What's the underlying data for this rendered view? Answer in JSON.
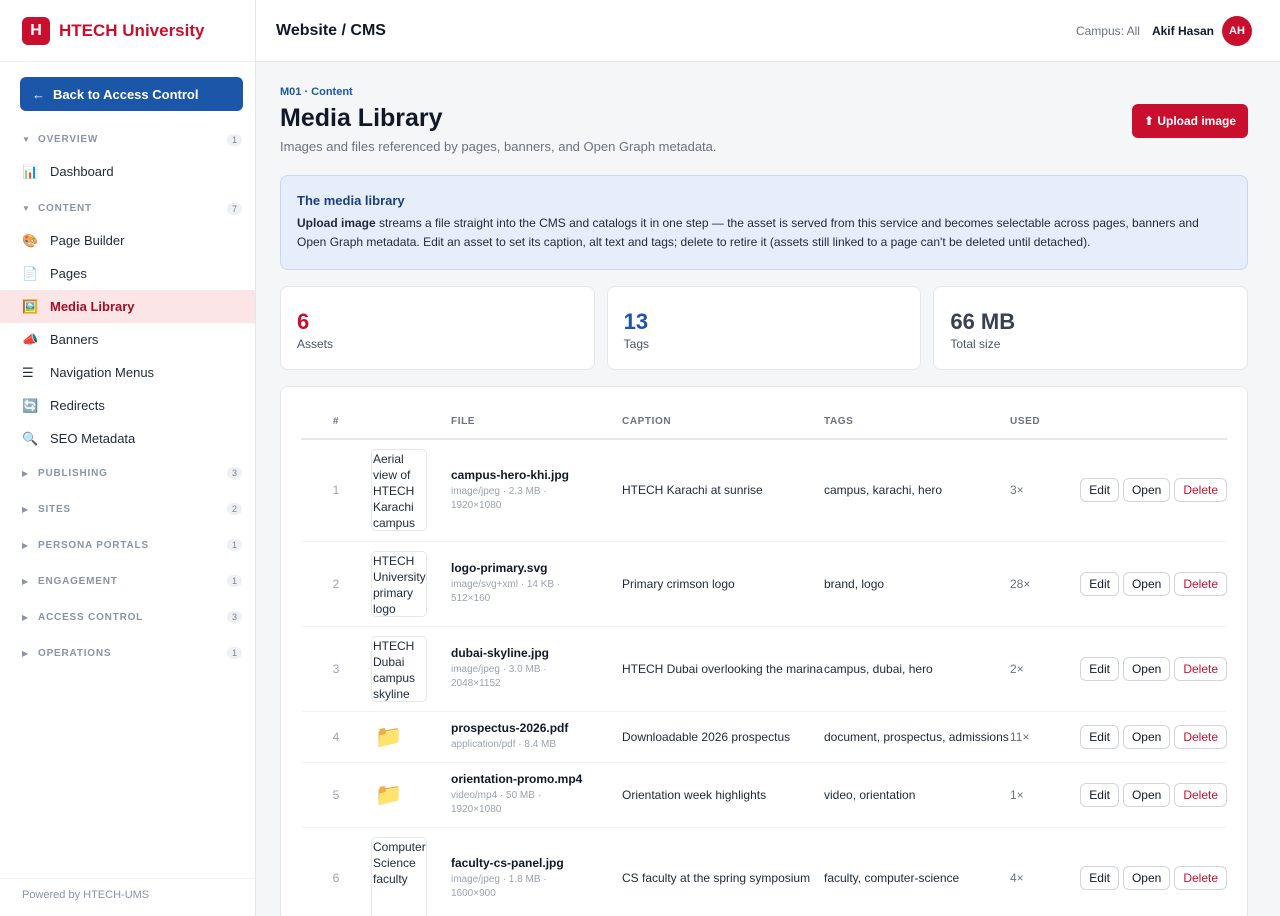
{
  "brand": {
    "logo_letter": "H",
    "name": "HTECH University"
  },
  "sidebar": {
    "back_label": "Back to Access Control",
    "back_arrow": "←",
    "overview": {
      "label": "OVERVIEW",
      "count": "1",
      "items": [
        {
          "icon": "📊",
          "label": "Dashboard"
        }
      ]
    },
    "content": {
      "label": "CONTENT",
      "count": "7",
      "items": [
        {
          "icon": "🎨",
          "label": "Page Builder"
        },
        {
          "icon": "📄",
          "label": "Pages"
        },
        {
          "icon": "🖼️",
          "label": "Media Library"
        },
        {
          "icon": "📣",
          "label": "Banners"
        },
        {
          "icon": "☰",
          "label": "Navigation Menus"
        },
        {
          "icon": "🔄",
          "label": "Redirects"
        },
        {
          "icon": "🔍",
          "label": "SEO Metadata"
        }
      ]
    },
    "sections": [
      {
        "label": "PUBLISHING",
        "count": "3"
      },
      {
        "label": "SITES",
        "count": "2"
      },
      {
        "label": "PERSONA PORTALS",
        "count": "1"
      },
      {
        "label": "ENGAGEMENT",
        "count": "1"
      },
      {
        "label": "ACCESS CONTROL",
        "count": "3"
      },
      {
        "label": "OPERATIONS",
        "count": "1"
      }
    ],
    "footer": "Powered by HTECH-UMS"
  },
  "topbar": {
    "title": "Website / CMS",
    "campus": "Campus: All",
    "user": "Akif Hasan",
    "initials": "AH"
  },
  "page": {
    "eyebrow": "M01 · Content",
    "title": "Media Library",
    "subtitle": "Images and files referenced by pages, banners, and Open Graph metadata.",
    "upload_label": "⬆ Upload image"
  },
  "info": {
    "title": "The media library",
    "lead": "Upload image",
    "body": " streams a file straight into the CMS and catalogs it in one step — the asset is served from this service and becomes selectable across pages, banners and Open Graph metadata. Edit an asset to set its caption, alt text and tags; delete to retire it (assets still linked to a page can't be deleted until detached)."
  },
  "stats": [
    {
      "value": "6",
      "label": "Assets"
    },
    {
      "value": "13",
      "label": "Tags"
    },
    {
      "value": "66 MB",
      "label": "Total size"
    }
  ],
  "table": {
    "headers": {
      "idx": "#",
      "file": "FILE",
      "caption": "CAPTION",
      "tags": "TAGS",
      "used": "USED"
    },
    "actions": {
      "edit": "Edit",
      "open": "Open",
      "delete": "Delete"
    },
    "rows": [
      {
        "idx": "1",
        "thumb": "Aerial view of HTECH Karachi campus",
        "name": "campus-hero-khi.jpg",
        "meta1": "image/jpeg · 2.3 MB ·",
        "meta2": "1920×1080",
        "caption": "HTECH Karachi at sunrise",
        "tags": "campus, karachi, hero",
        "used": "3×"
      },
      {
        "idx": "2",
        "thumb": "HTECH University primary logo",
        "name": "logo-primary.svg",
        "meta1": "image/svg+xml · 14 KB ·",
        "meta2": "512×160",
        "caption": "Primary crimson logo",
        "tags": "brand, logo",
        "used": "28×"
      },
      {
        "idx": "3",
        "thumb": "HTECH Dubai campus skyline",
        "name": "dubai-skyline.jpg",
        "meta1": "image/jpeg · 3.0 MB ·",
        "meta2": "2048×1152",
        "caption": "HTECH Dubai overlooking the marina",
        "tags": "campus, dubai, hero",
        "used": "2×"
      },
      {
        "idx": "4",
        "folder": "📁",
        "name": "prospectus-2026.pdf",
        "meta1": "application/pdf · 8.4 MB",
        "meta2": "",
        "caption": "Downloadable 2026 prospectus",
        "tags": "document, prospectus, admissions",
        "used": "11×"
      },
      {
        "idx": "5",
        "folder": "📁",
        "name": "orientation-promo.mp4",
        "meta1": "video/mp4 · 50 MB ·",
        "meta2": "1920×1080",
        "caption": "Orientation week highlights",
        "tags": "video, orientation",
        "used": "1×"
      },
      {
        "idx": "6",
        "thumb": "Computer Science faculty",
        "name": "faculty-cs-panel.jpg",
        "meta1": "image/jpeg · 1.8 MB ·",
        "meta2": "1600×900",
        "caption": "CS faculty at the spring symposium",
        "tags": "faculty, computer-science",
        "used": "4×"
      }
    ]
  }
}
